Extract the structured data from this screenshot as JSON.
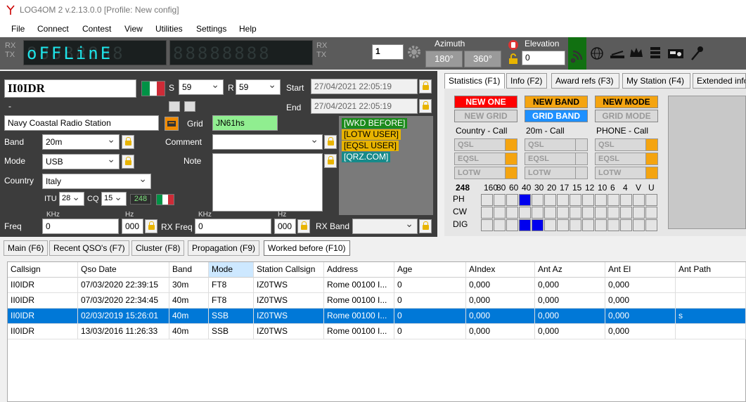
{
  "app": {
    "title": "LOG4OM 2 v.2.13.0.0 [Profile: New config]"
  },
  "menu": [
    "File",
    "Connect",
    "Contest",
    "View",
    "Utilities",
    "Settings",
    "Help"
  ],
  "toolbar": {
    "rx": "RX",
    "tx": "TX",
    "display1_text": "oFFLinE",
    "display1_ghost": "88888888",
    "display2_ghost": "88888888",
    "rx2": "RX",
    "tx2": "TX",
    "spin_value": "1",
    "azimuth_label": "Azimuth",
    "az_180": "180°",
    "az_360": "360°",
    "elevation_label": "Elevation",
    "elevation_value": "0"
  },
  "qso": {
    "callsign": "II0IDR",
    "s_label": "S",
    "s_value": "59",
    "r_label": "R",
    "r_value": "59",
    "start_label": "Start",
    "start_value": "27/04/2021 22:05:19",
    "end_label": "End",
    "end_value": "27/04/2021 22:05:19",
    "dash": "-",
    "name": "Navy Coastal Radio Station",
    "grid_label": "Grid",
    "grid_value": "JN61hs",
    "band_label": "Band",
    "band_value": "20m",
    "comment_label": "Comment",
    "comment_value": "",
    "mode_label": "Mode",
    "mode_value": "USB",
    "note_label": "Note",
    "country_label": "Country",
    "country_value": "Italy",
    "itu_label": "ITU",
    "itu_value": "28",
    "cq_label": "CQ",
    "cq_value": "15",
    "dxcc": "248",
    "khz": "KHz",
    "hz": "Hz",
    "freq_label": "Freq",
    "freq_value": "0",
    "freq_hz": "000",
    "rxfreq_label": "RX Freq",
    "rxfreq_value": "0",
    "rxfreq_hz": "000",
    "rxband_label": "RX Band",
    "rxband_value": ""
  },
  "worked_badges": [
    {
      "text": "[WKD BEFORE]",
      "bg": "#1b8a1b",
      "fg": "#ffffff"
    },
    {
      "text": "[LOTW USER]",
      "bg": "#e8b400",
      "fg": "#000000"
    },
    {
      "text": "[EQSL USER]",
      "bg": "#e8b400",
      "fg": "#000000"
    },
    {
      "text": "[QRZ.COM]",
      "bg": "#178a8a",
      "fg": "#ffffff"
    }
  ],
  "right_tabs": [
    "Statistics (F1)",
    "Info (F2)",
    "Award refs (F3)",
    "My Station (F4)",
    "Extended info"
  ],
  "stats": {
    "new_one": "NEW ONE",
    "new_band": "NEW BAND",
    "new_mode": "NEW MODE",
    "new_grid": "NEW GRID",
    "grid_band": "GRID BAND",
    "grid_mode": "GRID MODE",
    "col_titles": [
      "Country - Call",
      "20m - Call",
      "PHONE - Call"
    ],
    "rows": [
      "QSL",
      "EQSL",
      "LOTW"
    ],
    "count": "248",
    "bands": [
      "160",
      "80",
      "60",
      "40",
      "30",
      "20",
      "17",
      "15",
      "12",
      "10",
      "6",
      "4",
      "V",
      "U"
    ],
    "modes": [
      "PH",
      "CW",
      "DIG"
    ],
    "colors": {
      "new_one": "#ff0000",
      "new_band": "#f4a410",
      "new_mode": "#f4a410",
      "grid_band": "#1e90ff",
      "worked_cell": "#0000ee"
    }
  },
  "bottom_tabs": [
    "Main (F6)",
    "Recent QSO's (F7)",
    "Cluster (F8)",
    "Propagation (F9)",
    "Worked before (F10)"
  ],
  "table": {
    "headers": [
      "Callsign",
      "Qso Date",
      "Band",
      "Mode",
      "Station Callsign",
      "Address",
      "Age",
      "AIndex",
      "Ant Az",
      "Ant El",
      "Ant Path"
    ],
    "rows": [
      [
        "II0IDR",
        "07/03/2020 22:39:15",
        "30m",
        "FT8",
        "IZ0TWS",
        "Rome 00100 I...",
        "0",
        "0,000",
        "0,000",
        "0,000",
        ""
      ],
      [
        "II0IDR",
        "07/03/2020 22:34:45",
        "40m",
        "FT8",
        "IZ0TWS",
        "Rome 00100 I...",
        "0",
        "0,000",
        "0,000",
        "0,000",
        ""
      ],
      [
        "II0IDR",
        "02/03/2019 15:26:01",
        "40m",
        "SSB",
        "IZ0TWS",
        "Rome 00100 I...",
        "0",
        "0,000",
        "0,000",
        "0,000",
        "s"
      ],
      [
        "II0IDR",
        "13/03/2016 11:26:33",
        "40m",
        "SSB",
        "IZ0TWS",
        "Rome 00100 I...",
        "0",
        "0,000",
        "0,000",
        "0,000",
        ""
      ]
    ],
    "selected_row": 2
  }
}
